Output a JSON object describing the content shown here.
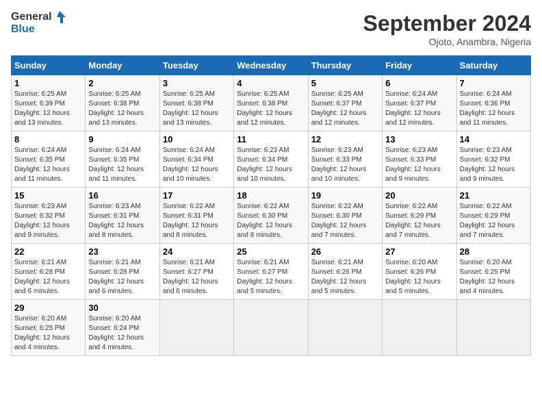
{
  "logo": {
    "line1": "General",
    "line2": "Blue"
  },
  "title": "September 2024",
  "location": "Ojoto, Anambra, Nigeria",
  "weekdays": [
    "Sunday",
    "Monday",
    "Tuesday",
    "Wednesday",
    "Thursday",
    "Friday",
    "Saturday"
  ],
  "weeks": [
    [
      {
        "day": "1",
        "sunrise": "6:25 AM",
        "sunset": "6:39 PM",
        "daylight": "12 hours and 13 minutes."
      },
      {
        "day": "2",
        "sunrise": "6:25 AM",
        "sunset": "6:38 PM",
        "daylight": "12 hours and 13 minutes."
      },
      {
        "day": "3",
        "sunrise": "6:25 AM",
        "sunset": "6:38 PM",
        "daylight": "12 hours and 13 minutes."
      },
      {
        "day": "4",
        "sunrise": "6:25 AM",
        "sunset": "6:38 PM",
        "daylight": "12 hours and 12 minutes."
      },
      {
        "day": "5",
        "sunrise": "6:25 AM",
        "sunset": "6:37 PM",
        "daylight": "12 hours and 12 minutes."
      },
      {
        "day": "6",
        "sunrise": "6:24 AM",
        "sunset": "6:37 PM",
        "daylight": "12 hours and 12 minutes."
      },
      {
        "day": "7",
        "sunrise": "6:24 AM",
        "sunset": "6:36 PM",
        "daylight": "12 hours and 11 minutes."
      }
    ],
    [
      {
        "day": "8",
        "sunrise": "6:24 AM",
        "sunset": "6:35 PM",
        "daylight": "12 hours and 11 minutes."
      },
      {
        "day": "9",
        "sunrise": "6:24 AM",
        "sunset": "6:35 PM",
        "daylight": "12 hours and 11 minutes."
      },
      {
        "day": "10",
        "sunrise": "6:24 AM",
        "sunset": "6:34 PM",
        "daylight": "12 hours and 10 minutes."
      },
      {
        "day": "11",
        "sunrise": "6:23 AM",
        "sunset": "6:34 PM",
        "daylight": "12 hours and 10 minutes."
      },
      {
        "day": "12",
        "sunrise": "6:23 AM",
        "sunset": "6:33 PM",
        "daylight": "12 hours and 10 minutes."
      },
      {
        "day": "13",
        "sunrise": "6:23 AM",
        "sunset": "6:33 PM",
        "daylight": "12 hours and 9 minutes."
      },
      {
        "day": "14",
        "sunrise": "6:23 AM",
        "sunset": "6:32 PM",
        "daylight": "12 hours and 9 minutes."
      }
    ],
    [
      {
        "day": "15",
        "sunrise": "6:23 AM",
        "sunset": "6:32 PM",
        "daylight": "12 hours and 9 minutes."
      },
      {
        "day": "16",
        "sunrise": "6:23 AM",
        "sunset": "6:31 PM",
        "daylight": "12 hours and 8 minutes."
      },
      {
        "day": "17",
        "sunrise": "6:22 AM",
        "sunset": "6:31 PM",
        "daylight": "12 hours and 8 minutes."
      },
      {
        "day": "18",
        "sunrise": "6:22 AM",
        "sunset": "6:30 PM",
        "daylight": "12 hours and 8 minutes."
      },
      {
        "day": "19",
        "sunrise": "6:22 AM",
        "sunset": "6:30 PM",
        "daylight": "12 hours and 7 minutes."
      },
      {
        "day": "20",
        "sunrise": "6:22 AM",
        "sunset": "6:29 PM",
        "daylight": "12 hours and 7 minutes."
      },
      {
        "day": "21",
        "sunrise": "6:22 AM",
        "sunset": "6:29 PM",
        "daylight": "12 hours and 7 minutes."
      }
    ],
    [
      {
        "day": "22",
        "sunrise": "6:21 AM",
        "sunset": "6:28 PM",
        "daylight": "12 hours and 6 minutes."
      },
      {
        "day": "23",
        "sunrise": "6:21 AM",
        "sunset": "6:28 PM",
        "daylight": "12 hours and 6 minutes."
      },
      {
        "day": "24",
        "sunrise": "6:21 AM",
        "sunset": "6:27 PM",
        "daylight": "12 hours and 6 minutes."
      },
      {
        "day": "25",
        "sunrise": "6:21 AM",
        "sunset": "6:27 PM",
        "daylight": "12 hours and 5 minutes."
      },
      {
        "day": "26",
        "sunrise": "6:21 AM",
        "sunset": "6:26 PM",
        "daylight": "12 hours and 5 minutes."
      },
      {
        "day": "27",
        "sunrise": "6:20 AM",
        "sunset": "6:26 PM",
        "daylight": "12 hours and 5 minutes."
      },
      {
        "day": "28",
        "sunrise": "6:20 AM",
        "sunset": "6:25 PM",
        "daylight": "12 hours and 4 minutes."
      }
    ],
    [
      {
        "day": "29",
        "sunrise": "6:20 AM",
        "sunset": "6:25 PM",
        "daylight": "12 hours and 4 minutes."
      },
      {
        "day": "30",
        "sunrise": "6:20 AM",
        "sunset": "6:24 PM",
        "daylight": "12 hours and 4 minutes."
      },
      null,
      null,
      null,
      null,
      null
    ]
  ]
}
